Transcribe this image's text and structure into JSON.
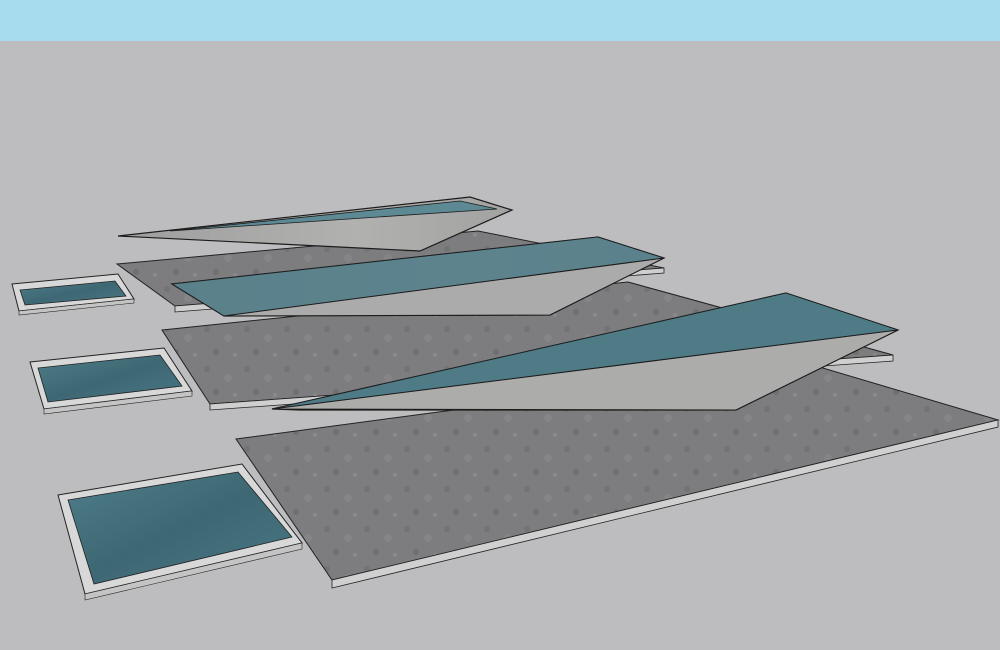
{
  "scene": {
    "description_free": true,
    "colors": {
      "sky": "#a6dcee",
      "ground": "#bdbdbf",
      "slab": "#7b7b7d",
      "slab_edge": "#c9c9c9",
      "pool_frame": "#d6d6d6",
      "water": "#3f6b78",
      "wedge_side": "#a9a9a8",
      "wedge_water": "#4e7b86",
      "outline": "#1c1c1c"
    },
    "objects": [
      {
        "kind": "slab-with-pool",
        "row": "back"
      },
      {
        "kind": "slab-with-pool",
        "row": "middle"
      },
      {
        "kind": "slab-with-pool",
        "row": "front"
      },
      {
        "kind": "wedge-basin",
        "row": "back"
      },
      {
        "kind": "wedge-basin",
        "row": "middle"
      },
      {
        "kind": "wedge-basin",
        "row": "front"
      }
    ]
  }
}
